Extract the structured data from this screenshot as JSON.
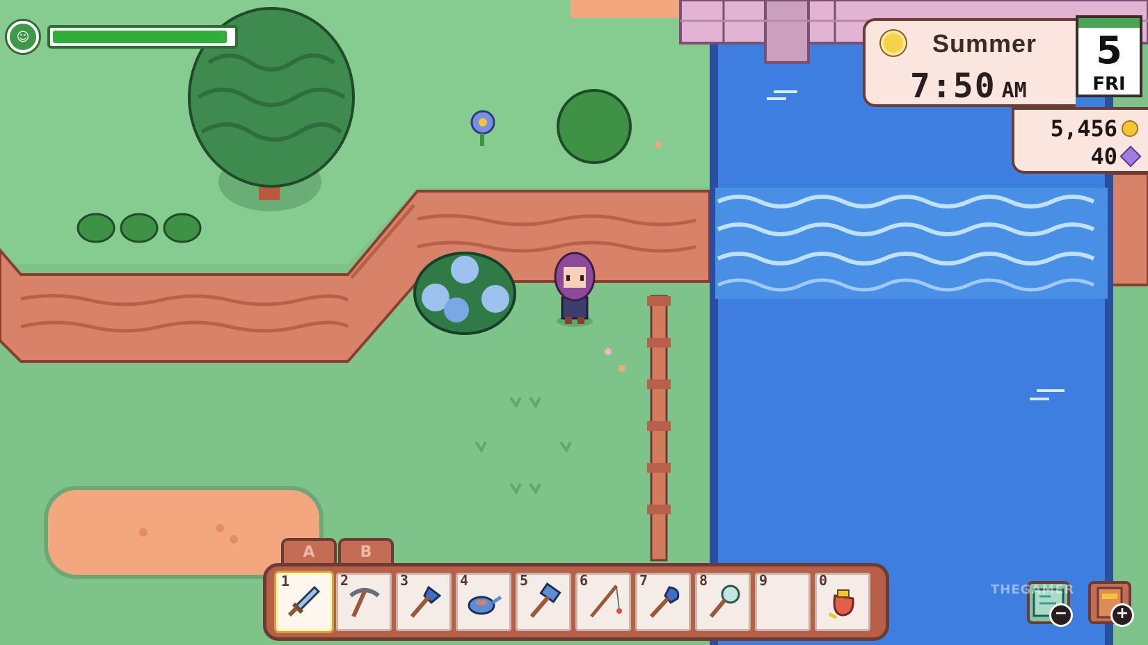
{
  "hud": {
    "stamina": {
      "icon": "stamina-face-icon",
      "level": 0.97
    },
    "clock": {
      "season": "Summer",
      "season_icon": "sun-icon",
      "time": "7:50",
      "ampm": "AM"
    },
    "calendar": {
      "day": "5",
      "weekday": "FRI"
    },
    "currency": {
      "gold": "5,456",
      "gems": "40"
    }
  },
  "toolbar": {
    "tabs": [
      "A",
      "B"
    ],
    "active_tab": "A",
    "selected_slot": 0,
    "slots": [
      {
        "number": "1",
        "item": "sword-icon"
      },
      {
        "number": "2",
        "item": "pickaxe-icon"
      },
      {
        "number": "3",
        "item": "axe-icon"
      },
      {
        "number": "4",
        "item": "watering-can-icon"
      },
      {
        "number": "5",
        "item": "hammer-icon"
      },
      {
        "number": "6",
        "item": "fishing-rod-icon"
      },
      {
        "number": "7",
        "item": "shovel-icon"
      },
      {
        "number": "8",
        "item": "net-icon"
      },
      {
        "number": "9",
        "item": ""
      },
      {
        "number": "0",
        "item": "seed-bag-icon"
      }
    ]
  },
  "corner_buttons": [
    {
      "icon": "map-icon",
      "badge": "−"
    },
    {
      "icon": "journal-icon",
      "badge": "+"
    }
  ],
  "watermark": "THEGAMER",
  "colors": {
    "grass": "#7ec48a",
    "cliff": "#d9826a",
    "water": "#3d7fe0",
    "ui_panel": "#fbe6df",
    "toolbar": "#b85f48"
  }
}
